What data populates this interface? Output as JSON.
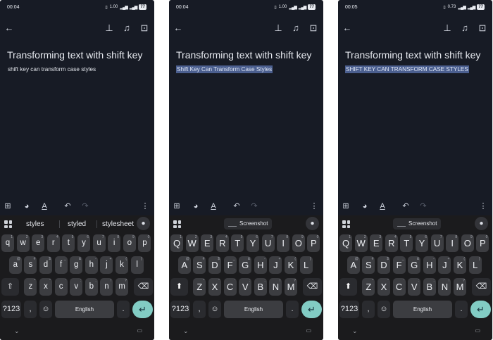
{
  "status": {
    "time1": "00:04",
    "time2": "00:04",
    "time3": "00:05",
    "data1": "1.00",
    "data2": "1.00",
    "data3": "0.73",
    "battery": "77"
  },
  "appbar": {
    "back_icon": "back-arrow-icon",
    "pin_icon": "pin-icon",
    "reminder_icon": "bell-plus-icon",
    "archive_icon": "archive-icon"
  },
  "note": {
    "title": "Transforming text with shift key",
    "body1": "shift key can transform case styles",
    "body2": "Shift Key Can Transform Case Styles",
    "body3": "SHIFT KEY CAN TRANSFORM CASE STYLES",
    "selection_color": "#4b5f8f"
  },
  "toolbar": {
    "icons": [
      "add-box-icon",
      "palette-icon",
      "text-format-icon",
      "undo-icon",
      "redo-icon",
      "more-vert-icon"
    ]
  },
  "suggestions": {
    "words": [
      "styles",
      "styled",
      "stylesheet"
    ],
    "chip_label": "Screenshot"
  },
  "keyboard": {
    "row1_lower": [
      "q",
      "w",
      "e",
      "r",
      "t",
      "y",
      "u",
      "i",
      "o",
      "p"
    ],
    "row1_upper": [
      "Q",
      "W",
      "E",
      "R",
      "T",
      "Y",
      "U",
      "I",
      "O",
      "P"
    ],
    "row1_hints": [
      "1",
      "2",
      "3",
      "4",
      "5",
      "6",
      "7",
      "8",
      "9",
      "0"
    ],
    "row2_lower": [
      "a",
      "s",
      "d",
      "f",
      "g",
      "h",
      "j",
      "k",
      "l"
    ],
    "row2_upper": [
      "A",
      "S",
      "D",
      "F",
      "G",
      "H",
      "J",
      "K",
      "L"
    ],
    "row2_hints": [
      "@",
      "#",
      "$",
      "_",
      "&",
      "-",
      "+",
      "(",
      ")"
    ],
    "row3_lower": [
      "z",
      "x",
      "c",
      "v",
      "b",
      "n",
      "m"
    ],
    "row3_upper": [
      "Z",
      "X",
      "C",
      "V",
      "B",
      "N",
      "M"
    ],
    "row3_hints": [
      "*",
      "\"",
      "'",
      ":",
      ";",
      "!",
      "?"
    ],
    "symbols": "?123",
    "comma": ",",
    "period": ".",
    "space": "English",
    "shift_glyph": "⇧",
    "shift_active_glyph": "⬆",
    "backspace_glyph": "⌫",
    "emoji_glyph": "☺",
    "enter_glyph": "↵",
    "enter_color": "#82ccc4"
  }
}
